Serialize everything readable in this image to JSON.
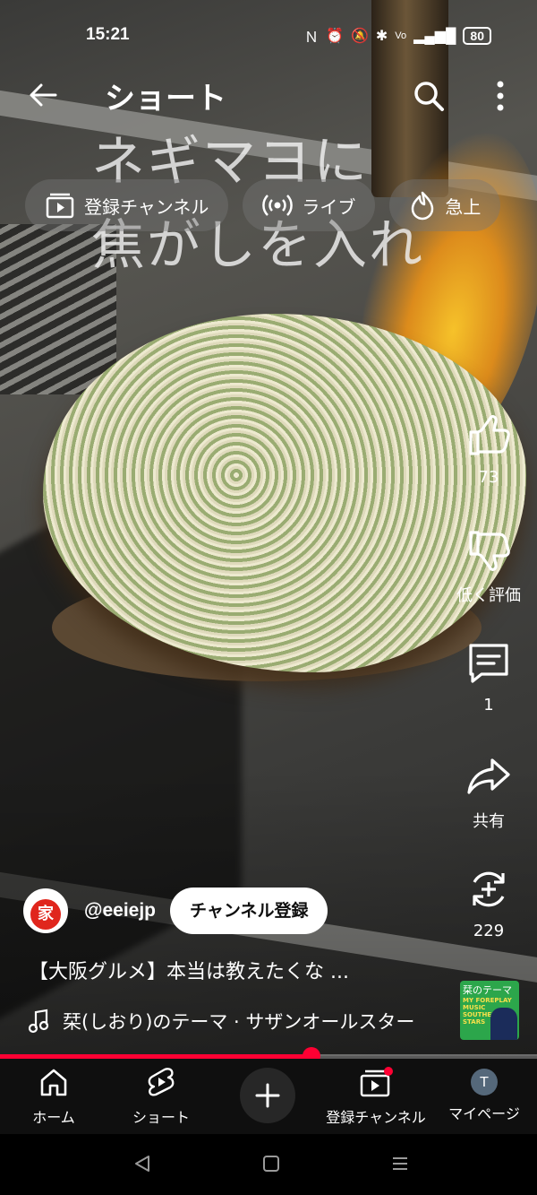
{
  "status_bar": {
    "time": "15:21",
    "icons": [
      "nfc-icon",
      "alarm-icon",
      "mute-icon",
      "bluetooth-icon",
      "volte-icon",
      "5g-signal-icon"
    ],
    "battery": "80"
  },
  "header": {
    "title": "ショート"
  },
  "video_caption": {
    "line1": "ネギマヨに",
    "line2": "焦がしを入れ"
  },
  "chips": [
    {
      "label": "登録チャンネル",
      "icon": "subscriptions-icon"
    },
    {
      "label": "ライブ",
      "icon": "live-icon"
    },
    {
      "label": "急上",
      "icon": "trending-icon"
    }
  ],
  "actions": {
    "like_count": "73",
    "dislike_label": "低く評価",
    "comment_count": "1",
    "share_label": "共有",
    "remix_count": "229"
  },
  "channel": {
    "handle": "@eeiejp",
    "avatar_char": "家",
    "subscribe_label": "チャンネル登録"
  },
  "video": {
    "title": "【大阪グルメ】本当は教えたくな ...",
    "music": "栞(しおり)のテーマ · サザンオールスター",
    "album_title": "栞のテーマ",
    "album_sub": "MY FOREPLAY MUSIC SOUTHERN ALL STARS",
    "progress": 0.58
  },
  "bottom_nav": [
    {
      "label": "ホーム",
      "icon": "home-icon"
    },
    {
      "label": "ショート",
      "icon": "shorts-icon"
    },
    {
      "label": "",
      "icon": "create-plus-icon"
    },
    {
      "label": "登録チャンネル",
      "icon": "subscriptions-icon"
    },
    {
      "label": "マイページ",
      "icon": "avatar-icon",
      "avatar_letter": "T"
    }
  ],
  "colors": {
    "accent": "#ff0033",
    "nav_bg": "#0f0f0f"
  }
}
